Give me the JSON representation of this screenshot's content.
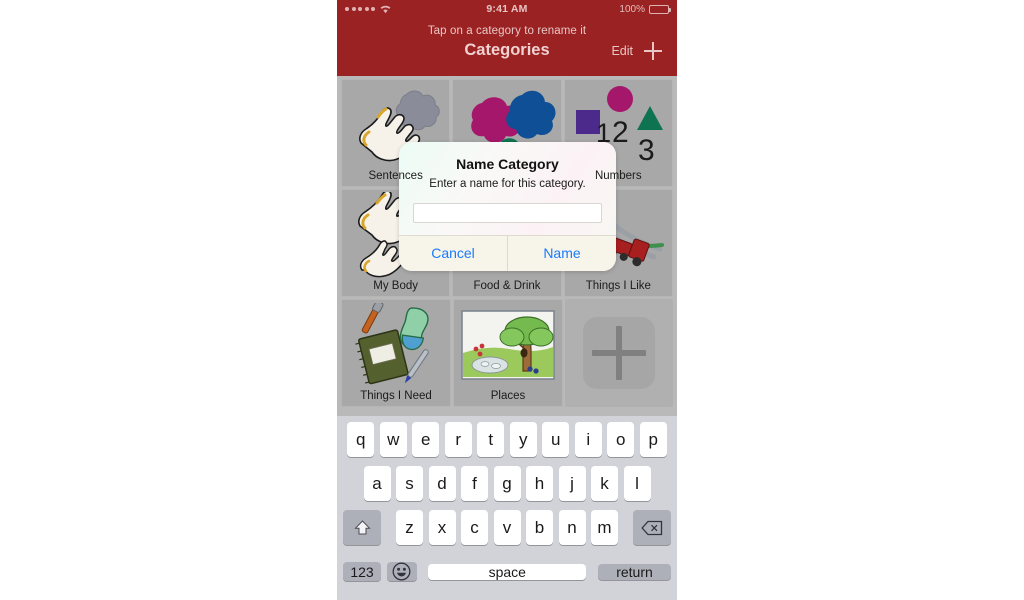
{
  "status_bar": {
    "signal_dots": 5,
    "wifi_icon": "wifi-icon",
    "time": "9:41 AM",
    "battery_percent": "100%",
    "battery_icon": "battery-full-icon"
  },
  "nav": {
    "hint": "Tap on a category to rename it",
    "title": "Categories",
    "edit_label": "Edit",
    "add_icon": "plus-icon"
  },
  "colors": {
    "header_red": "#9b2222",
    "grid_background": "#b9b9b9",
    "tile_background": "#a8a8a8",
    "keyboard_background": "#d2d3d8",
    "action_blue": "#1a7bff"
  },
  "categories": [
    {
      "label": "Sentences",
      "art": "hand-speech-blob-icon"
    },
    {
      "label": "",
      "art": "color-blobs-icon"
    },
    {
      "label": "Numbers",
      "art": "shapes-numbers-icon"
    },
    {
      "label": "My Body",
      "art": "hands-icon"
    },
    {
      "label": "Food & Drink",
      "art": "food-drink-icon"
    },
    {
      "label": "Things I Like",
      "art": "toy-train-icon"
    },
    {
      "label": "Things I Need",
      "art": "notebook-sock-pen-icon"
    },
    {
      "label": "Places",
      "art": "park-tree-pond-icon"
    },
    {
      "label": "",
      "art": "add-category-icon"
    }
  ],
  "alert": {
    "title": "Name Category",
    "message": "Enter a name for this category.",
    "input_value": "",
    "input_placeholder": "",
    "cancel_label": "Cancel",
    "confirm_label": "Name"
  },
  "keyboard": {
    "row1": [
      "q",
      "w",
      "e",
      "r",
      "t",
      "y",
      "u",
      "i",
      "o",
      "p"
    ],
    "row2": [
      "a",
      "s",
      "d",
      "f",
      "g",
      "h",
      "j",
      "k",
      "l"
    ],
    "row3": [
      "z",
      "x",
      "c",
      "v",
      "b",
      "n",
      "m"
    ],
    "shift_icon": "shift-up-arrow-icon",
    "backspace_icon": "backspace-delete-icon",
    "numbers_label": "123",
    "emoji_icon": "smiley-face-icon",
    "space_label": "space",
    "return_label": "return"
  }
}
